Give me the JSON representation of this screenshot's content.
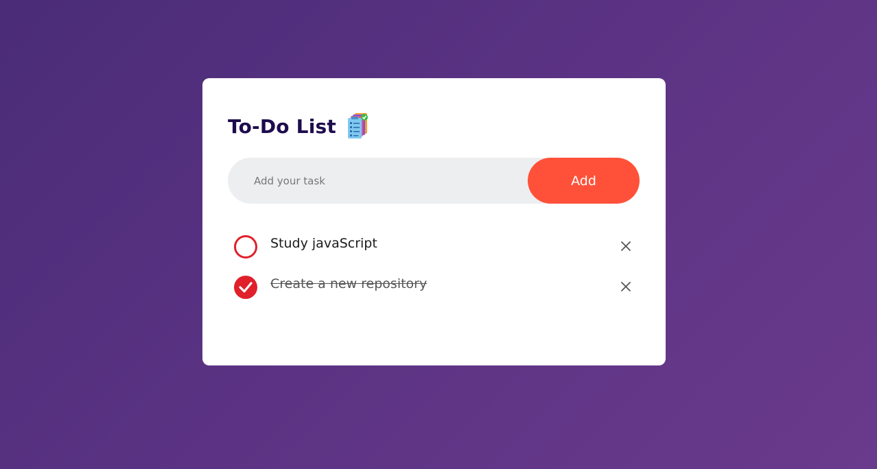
{
  "app": {
    "title": "To-Do List",
    "title_icon": "clipboard-checklist-icon"
  },
  "input": {
    "placeholder": "Add your task",
    "value": ""
  },
  "add_button": {
    "label": "Add"
  },
  "tasks": [
    {
      "text": "Study javaScript",
      "completed": false,
      "remove_icon": "close-icon"
    },
    {
      "text": "Create a new repository",
      "completed": true,
      "remove_icon": "close-icon"
    }
  ],
  "colors": {
    "accent": "#ff5139",
    "check": "#e0202a",
    "title": "#1e0c4d",
    "background_start": "#4a2c78",
    "background_end": "#6a3a8c"
  }
}
